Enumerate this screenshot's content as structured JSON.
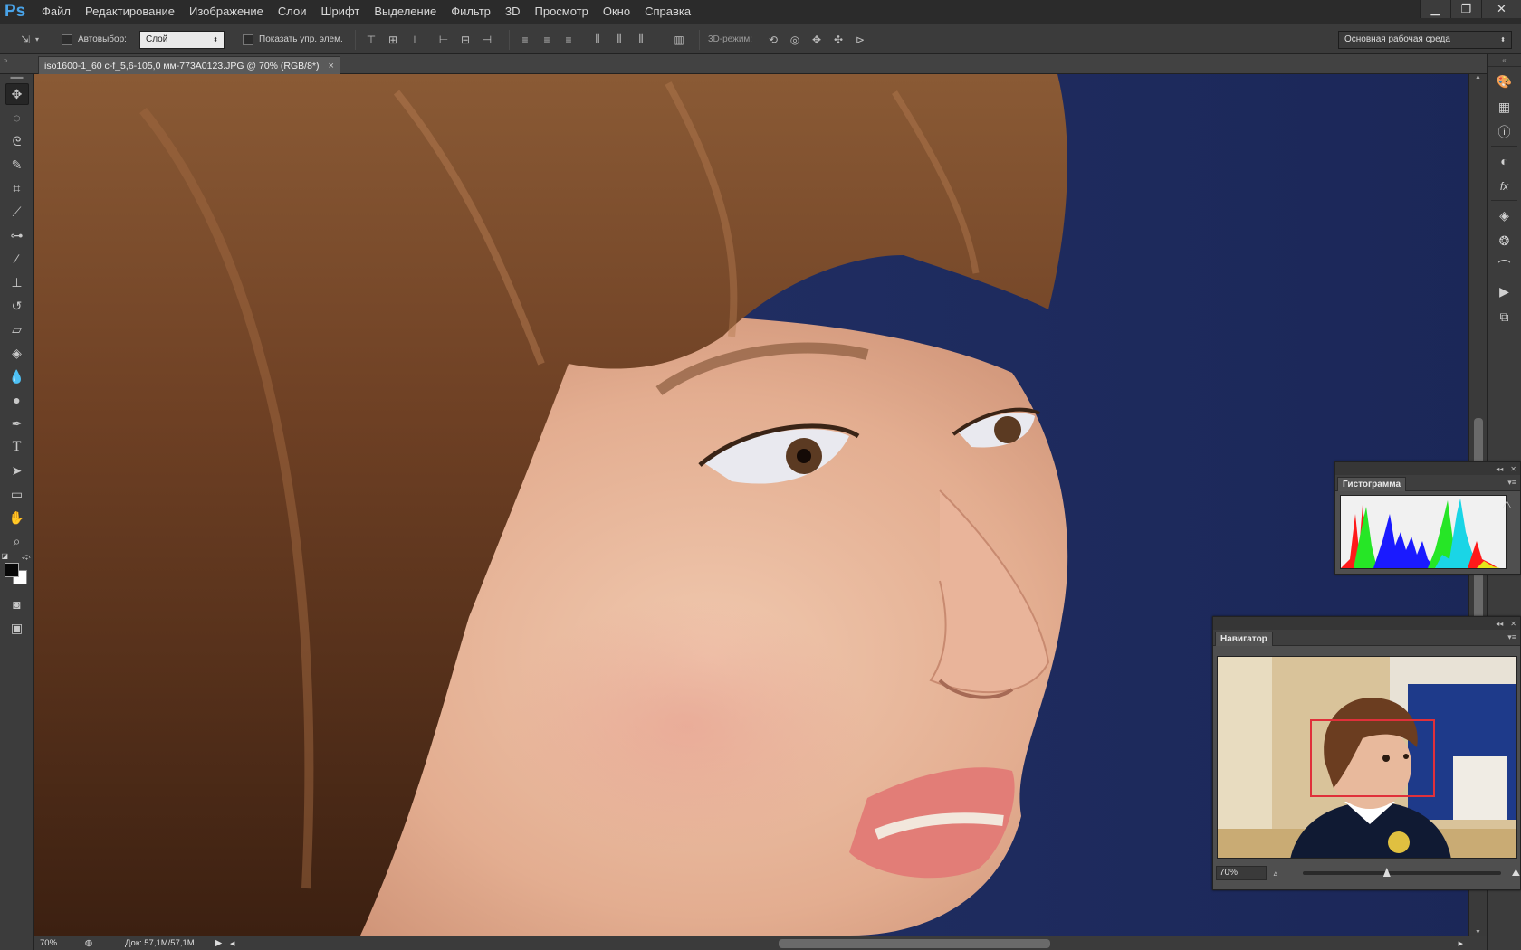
{
  "app": {
    "logo": "Ps"
  },
  "menu": [
    "Файл",
    "Редактирование",
    "Изображение",
    "Слои",
    "Шрифт",
    "Выделение",
    "Фильтр",
    "3D",
    "Просмотр",
    "Окно",
    "Справка"
  ],
  "window_controls": {
    "minimize_icon": "minimize-icon",
    "restore_icon": "restore-icon",
    "close_icon": "close-icon"
  },
  "options": {
    "autoselect_label": "Автовыбор:",
    "autoselect_value": "Слой",
    "show_controls_label": "Показать упр. элем.",
    "mode3d_label": "3D-режим:",
    "workspace": "Основная рабочая среда"
  },
  "document": {
    "tab_title": "iso1600-1_60 c-f_5,6-105,0 мм-773A0123.JPG @ 70% (RGB/8*)",
    "close_glyph": "×"
  },
  "status": {
    "zoom": "70%",
    "doc_info": "Док: 57,1M/57,1M"
  },
  "panels": {
    "histogram": {
      "title": "Гистограмма",
      "warning_icon": "warning-icon"
    },
    "navigator": {
      "title": "Навигатор",
      "zoom": "70%",
      "zoom_fraction": 0.42
    }
  },
  "colors": {
    "accent": "#49a3e8",
    "foreground": "#080808",
    "background": "#ffffff",
    "nav_view_box": "#e0303a"
  },
  "tools": [
    "move-tool",
    "marquee-tool",
    "lasso-tool",
    "quick-select-tool",
    "crop-tool",
    "eyedropper-tool",
    "spot-heal-tool",
    "brush-tool",
    "stamp-tool",
    "history-brush-tool",
    "eraser-tool",
    "bucket-tool",
    "blur-tool",
    "dodge-tool",
    "pen-tool",
    "type-tool",
    "path-select-tool",
    "rectangle-tool",
    "hand-tool",
    "zoom-tool"
  ],
  "dock_icons": [
    "color-panel-icon",
    "swatches-panel-icon",
    "info-panel-icon",
    "adjustments-icon",
    "styles-icon",
    "layers-icon",
    "channels-icon",
    "paths-icon",
    "actions-icon",
    "history-icon"
  ]
}
